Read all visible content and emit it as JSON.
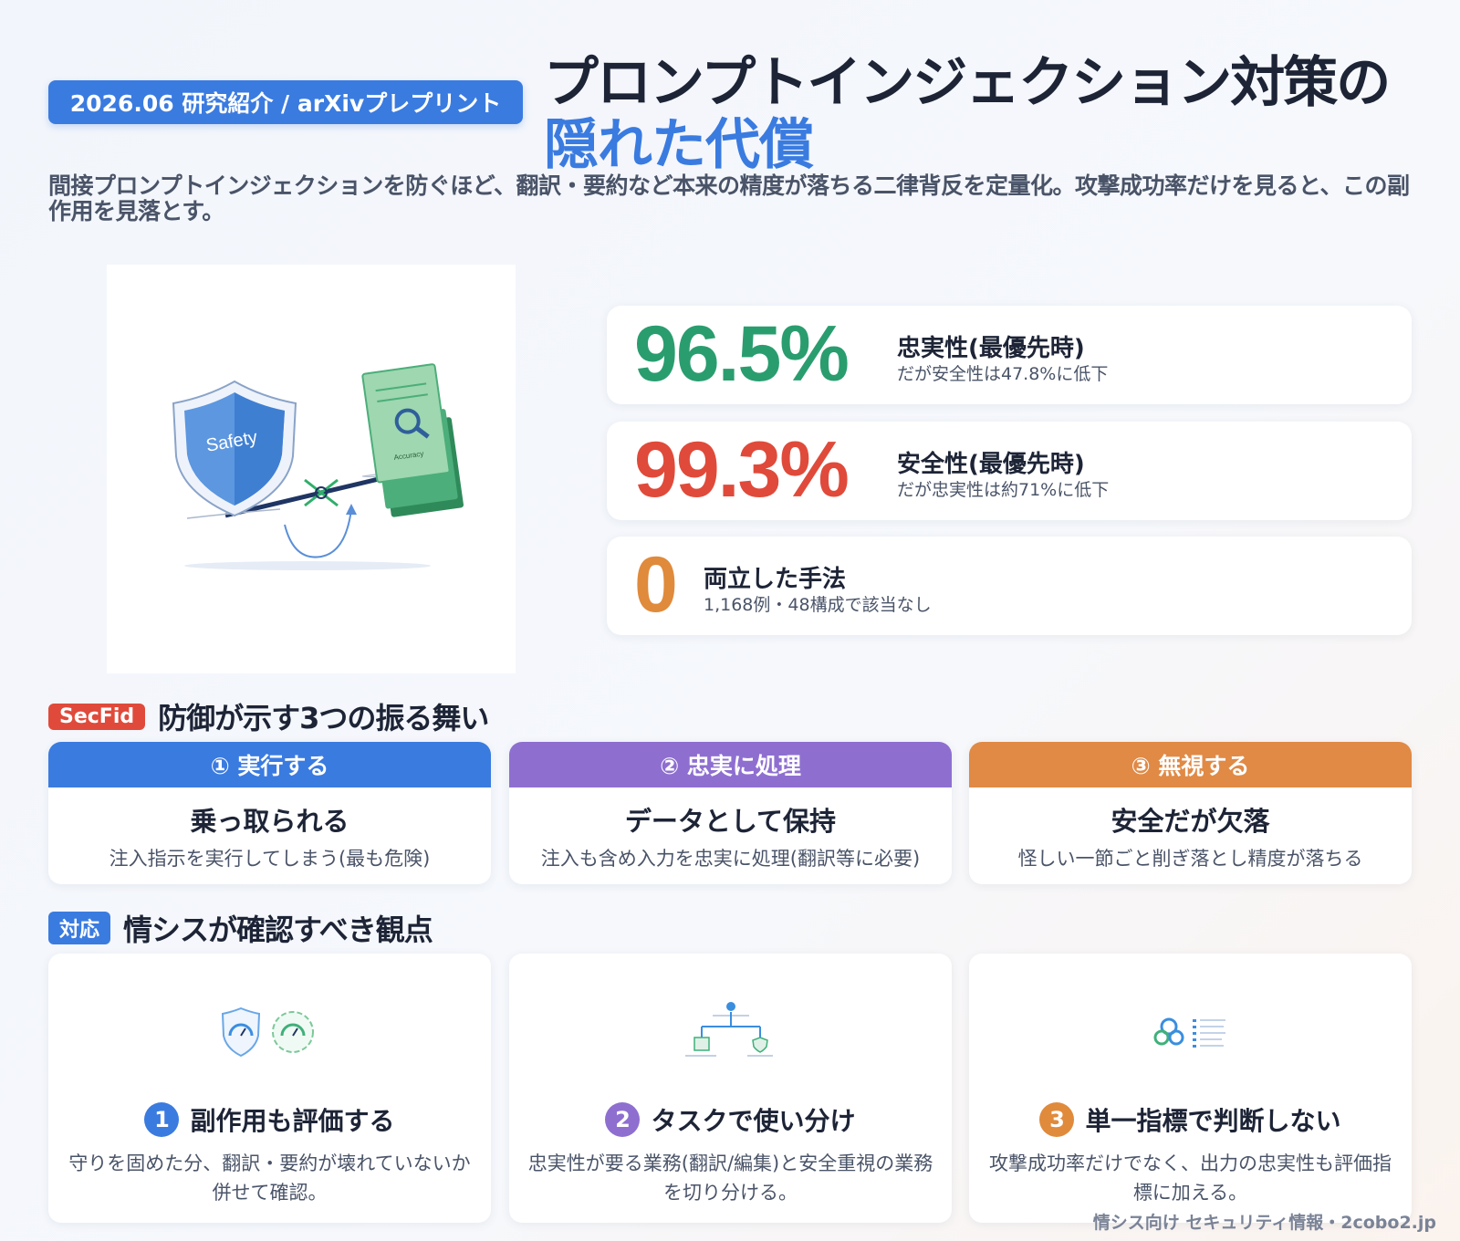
{
  "header": {
    "badge": "2026.06 研究紹介 / arXivプレプリント",
    "title_line1": "プロンプトインジェクション対策の",
    "title_line2": "隠れた代償",
    "subtitle": "間接プロンプトインジェクションを防ぐほど、翻訳・要約など本来の精度が落ちる二律背反を定量化。攻撃成功率だけを見ると、この副作用を見落とす。"
  },
  "hero_illustration": {
    "shield_text": "Safety",
    "doc_text": "Accuracy",
    "doc_header": "ΛPΛ\nΛVЯ"
  },
  "stats": [
    {
      "value": "96.5%",
      "label": "忠実性(最優先時)",
      "sub": "だが安全性は47.8%に低下",
      "color": "#2a9d6f"
    },
    {
      "value": "99.3%",
      "label": "安全性(最優先時)",
      "sub": "だが忠実性は約71%に低下",
      "color": "#e04a3a"
    },
    {
      "value": "0",
      "label": "両立した手法",
      "sub": "1,168例・48構成で該当なし",
      "color": "#e08a3c"
    }
  ],
  "behaviors_section": {
    "tag": "SecFid",
    "tag_color": "#e04a3a",
    "title": "防御が示す3つの振る舞い",
    "cards": [
      {
        "head": "① 実行する",
        "title": "乗っ取られる",
        "desc": "注入指示を実行してしまう(最も危険)",
        "color": "#3a7be0"
      },
      {
        "head": "② 忠実に処理",
        "title": "データとして保持",
        "desc": "注入も含め入力を忠実に処理(翻訳等に必要)",
        "color": "#8e6fd0"
      },
      {
        "head": "③ 無視する",
        "title": "安全だが欠落",
        "desc": "怪しい一節ごと削ぎ落とし精度が落ちる",
        "color": "#e08a46"
      }
    ]
  },
  "actions_section": {
    "tag": "対応",
    "tag_color": "#3a7be0",
    "title": "情シスが確認すべき観点",
    "cards": [
      {
        "num": "1",
        "title": "副作用も評価する",
        "desc": "守りを固めた分、翻訳・要約が壊れていないか併せて確認。",
        "color": "#3a7be0",
        "icon": "gauge-icons"
      },
      {
        "num": "2",
        "title": "タスクで使い分け",
        "desc": "忠実性が要る業務(翻訳/編集)と安全重視の業務を切り分ける。",
        "color": "#8e6fd0",
        "icon": "routing-diagram-icon"
      },
      {
        "num": "3",
        "title": "単一指標で判断しない",
        "desc": "攻撃成功率だけでなく、出力の忠実性も評価指標に加える。",
        "color": "#e08a3c",
        "icon": "gears-checklist-icon"
      }
    ]
  },
  "footer": "情シス向け セキュリティ情報・2cobo2.jp"
}
